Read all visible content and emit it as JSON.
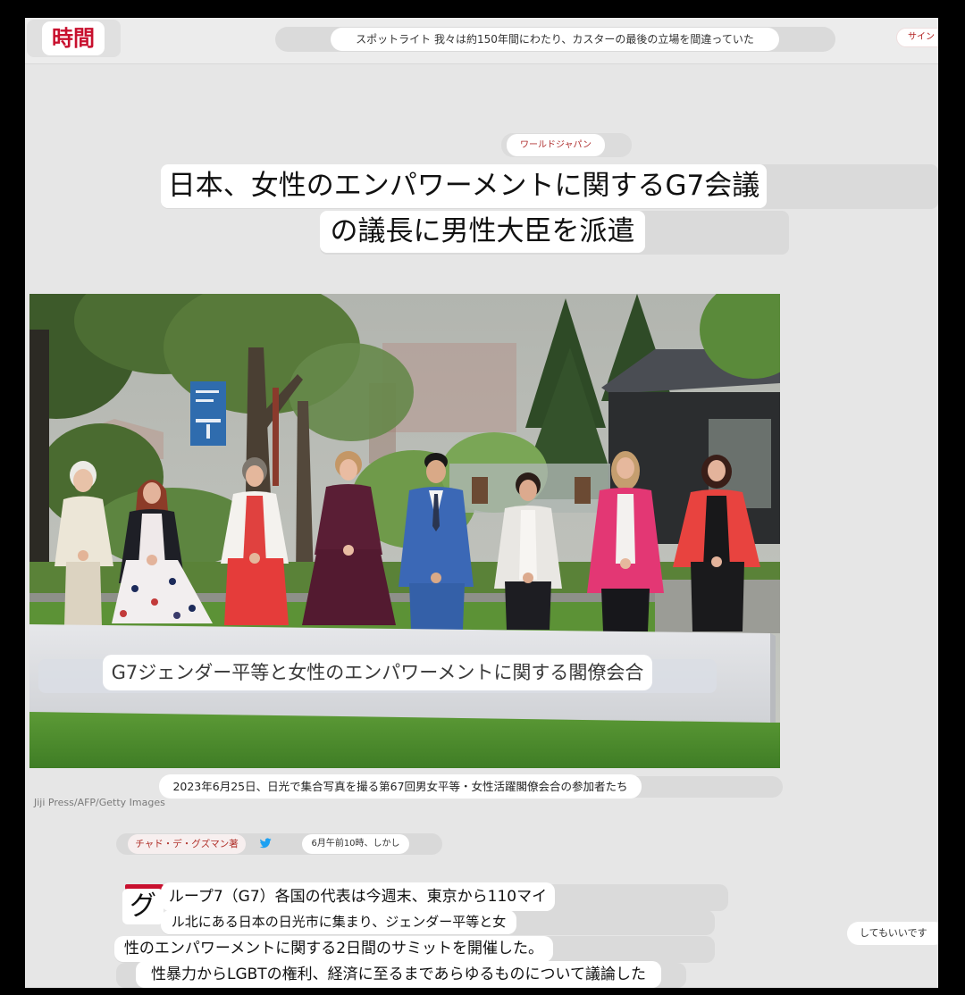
{
  "header": {
    "logo": "時間",
    "spotlight": "スポットライト 我々は約150年間にわたり、カスターの最後の立場を間違っていた",
    "signin": "サイン"
  },
  "article": {
    "category": "ワールドジャパン",
    "title": [
      "日本、女性のエンパワーメントに関するG7会議",
      "の議長に男性大臣を派遣"
    ],
    "photo": {
      "banner_text": "G7ジェンダー平等と女性のエンパワーメントに関する閣僚会合",
      "caption": "2023年6月25日、日光で集合写真を撮る第67回男女平等・女性活躍閣僚会合の参加者たち",
      "credit": "Jiji Press/AFP/Getty Images"
    },
    "byline": {
      "author": "チャド・デ・グズマン著",
      "author_icon": "twitter-icon",
      "time": "6月午前10時、しかし"
    },
    "body": {
      "drop_cap": "グ",
      "lines": [
        "ループ7（G7）各国の代表は今週末、東京から110マイ",
        "ル北にある日本の日光市に集まり、ジェンダー平等と女",
        "性のエンパワーメントに関する2日間のサミットを開催した。",
        "性暴力からLGBTの権利、経済に至るまであらゆるものについて議論した"
      ]
    }
  },
  "aside": {
    "text": "してもいいです"
  },
  "colors": {
    "brand_red": "#c8102e",
    "twitter_blue": "#1da1f2",
    "page_bg": "#e6e6e6",
    "overlay_bar": "#dadada",
    "pill_bg": "#ffffff"
  }
}
